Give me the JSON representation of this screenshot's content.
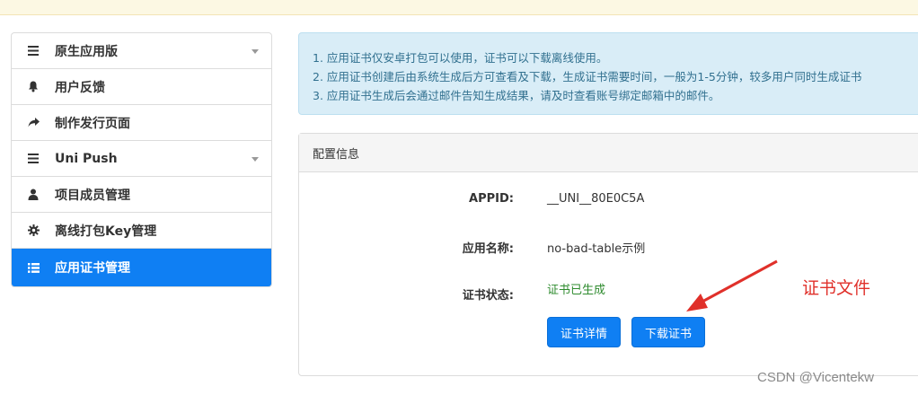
{
  "sidebar": {
    "items": [
      {
        "label": "原生应用版",
        "icon": "bars-icon",
        "has_caret": true
      },
      {
        "label": "用户反馈",
        "icon": "bell-icon",
        "has_caret": false
      },
      {
        "label": "制作发行页面",
        "icon": "share-arrow-icon",
        "has_caret": false
      },
      {
        "label": "Uni Push",
        "icon": "bars-icon",
        "has_caret": true
      },
      {
        "label": "项目成员管理",
        "icon": "user-icon",
        "has_caret": false
      },
      {
        "label": "离线打包Key管理",
        "icon": "gear-icon",
        "has_caret": false
      },
      {
        "label": "应用证书管理",
        "icon": "list-icon",
        "has_caret": false,
        "active": true
      }
    ]
  },
  "notice": {
    "lines": [
      "1. 应用证书仅安卓打包可以使用，证书可以下载离线使用。",
      "2. 应用证书创建后由系统生成后方可查看及下载，生成证书需要时间，一般为1-5分钟，较多用户同时生成证书",
      "3. 应用证书生成后会通过邮件告知生成结果，请及时查看账号绑定邮箱中的邮件。"
    ]
  },
  "panel": {
    "title": "配置信息",
    "appid_label": "APPID:",
    "appid_value": "__UNI__80E0C5A",
    "name_label": "应用名称:",
    "name_value": "no-bad-table示例",
    "status_label": "证书状态:",
    "status_value": "证书已生成",
    "detail_button": "证书详情",
    "download_button": "下载证书"
  },
  "annotation": {
    "text": "证书文件"
  },
  "watermark": "CSDN @Vicentekw",
  "colors": {
    "primary": "#0f7ff3",
    "notice_bg": "#d9edf7",
    "notice_text": "#31708f",
    "status_ok": "#2e8b2e",
    "annotation": "#e0302a"
  }
}
